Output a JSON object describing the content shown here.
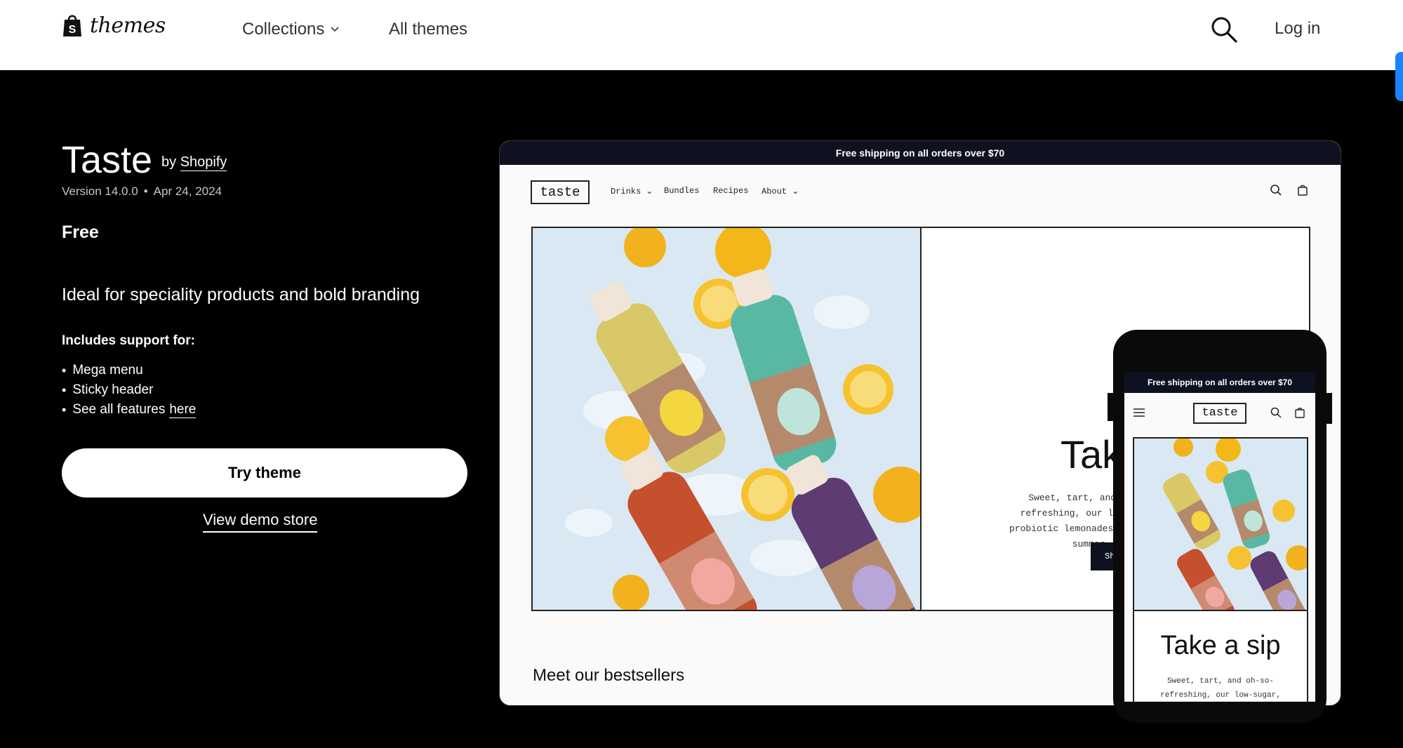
{
  "header": {
    "logo_text": "themes",
    "nav": [
      {
        "label": "Collections",
        "has_dropdown": true
      },
      {
        "label": "All themes",
        "has_dropdown": false
      }
    ],
    "login_label": "Log in",
    "icons": {
      "search": "search-icon",
      "logo": "shopify-bag-icon",
      "dropdown": "chevron-down-icon"
    }
  },
  "theme": {
    "name": "Taste",
    "by_prefix": "by",
    "author": "Shopify",
    "version": "Version 14.0.0",
    "separator": "•",
    "date": "Apr 24, 2024",
    "price": "Free",
    "tagline": "Ideal for speciality products and bold branding",
    "includes_heading": "Includes support for:",
    "features": [
      "Mega menu",
      "Sticky header"
    ],
    "see_all_text": "See all features",
    "see_all_link": "here",
    "try_button": "Try theme",
    "demo_link": "View demo store"
  },
  "preview": {
    "banner": "Free shipping on all orders over $70",
    "logo": "taste",
    "nav": [
      "Drinks",
      "Bundles",
      "Recipes",
      "About"
    ],
    "hero_title": "Take a sip",
    "hero_text": "Sweet, tart, and oh-so-refreshing, our low-sugar, probiotic lemonades taste like summer.",
    "hero_button": "Shop Lemonade",
    "section_title": "Meet our bestsellers"
  },
  "phone": {
    "banner": "Free shipping on all orders over $70",
    "logo": "taste",
    "hero_title": "Take a sip",
    "hero_text": "Sweet, tart, and oh-so-refreshing, our low-sugar,"
  },
  "colors": {
    "accent_blue": "#1a84ff",
    "dark_navy": "#0e1220"
  }
}
